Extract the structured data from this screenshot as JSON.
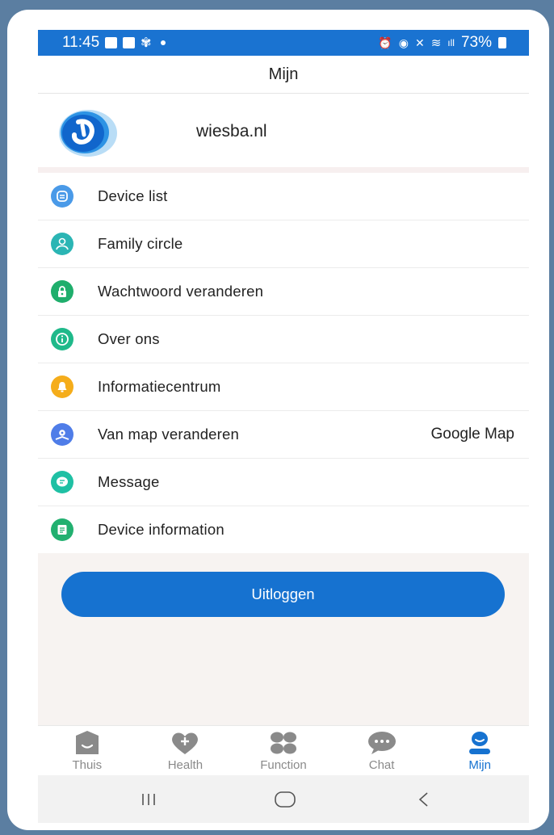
{
  "status_bar": {
    "time": "11:45",
    "battery": "73%",
    "signal_text": "ıll"
  },
  "header": {
    "title": "Mijn"
  },
  "profile": {
    "name": "wiesba.nl"
  },
  "menu": [
    {
      "label": "Device list",
      "icon": "device-list-icon",
      "color": "#4a9ae8"
    },
    {
      "label": "Family circle",
      "icon": "family-circle-icon",
      "color": "#2bb5b4"
    },
    {
      "label": "Wachtwoord veranderen",
      "icon": "lock-icon",
      "color": "#1fae6c"
    },
    {
      "label": "Over ons",
      "icon": "info-icon",
      "color": "#1fb98a"
    },
    {
      "label": "Informatiecentrum",
      "icon": "bell-icon",
      "color": "#f5ad1b"
    },
    {
      "label": "Van map veranderen",
      "value": "Google Map",
      "icon": "map-pin-icon",
      "color": "#4f7de8"
    },
    {
      "label": "Message",
      "icon": "message-icon",
      "color": "#1fc0a4"
    },
    {
      "label": "Device information",
      "icon": "document-icon",
      "color": "#22b070"
    }
  ],
  "logout_label": "Uitloggen",
  "tabs": [
    {
      "label": "Thuis",
      "icon": "home-watch-icon",
      "active": false
    },
    {
      "label": "Health",
      "icon": "heart-plus-icon",
      "active": false
    },
    {
      "label": "Function",
      "icon": "grid-function-icon",
      "active": false
    },
    {
      "label": "Chat",
      "icon": "chat-bubble-icon",
      "active": false
    },
    {
      "label": "Mijn",
      "icon": "profile-icon",
      "active": true
    }
  ],
  "colors": {
    "primary": "#1672d0",
    "status_bar": "#1a73d1",
    "tab_inactive": "#8a8a8a",
    "background_outer": "#5b7ea1"
  }
}
